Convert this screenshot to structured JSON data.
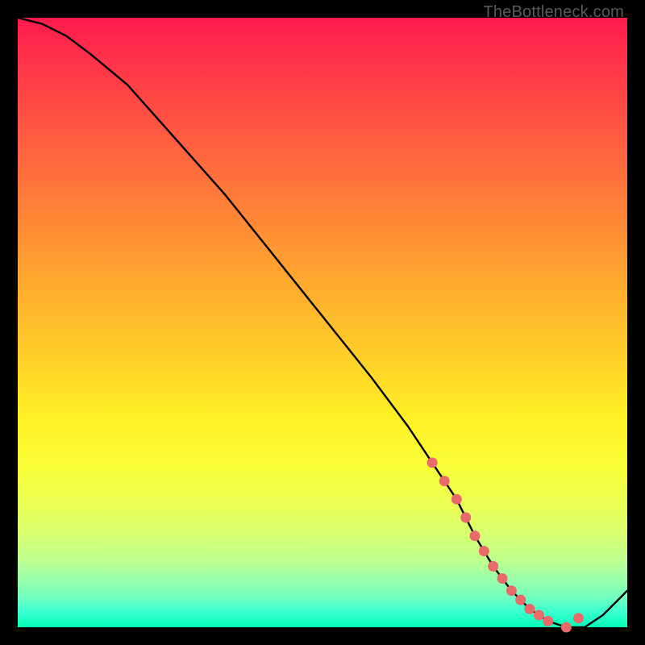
{
  "watermark": "TheBottleneck.com",
  "chart_data": {
    "type": "line",
    "title": "",
    "xlabel": "",
    "ylabel": "",
    "xlim": [
      0,
      100
    ],
    "ylim": [
      0,
      100
    ],
    "grid": false,
    "legend": false,
    "series": [
      {
        "name": "curve",
        "x": [
          0,
          4,
          8,
          12,
          18,
          26,
          34,
          42,
          50,
          58,
          64,
          68,
          72,
          75,
          78,
          81,
          84,
          87,
          90,
          93,
          96,
          100
        ],
        "values": [
          100,
          99,
          97,
          94,
          89,
          80,
          71,
          61,
          51,
          41,
          33,
          27,
          21,
          15,
          10,
          6,
          3,
          1,
          0,
          0,
          2,
          6
        ]
      }
    ],
    "markers": {
      "name": "highlight-dots",
      "color": "#e86a6a",
      "x": [
        68,
        70,
        72,
        73.5,
        75,
        76.5,
        78,
        79.5,
        81,
        82.5,
        84,
        85.5,
        87,
        90,
        92
      ],
      "values": [
        27,
        24,
        21,
        18,
        15,
        12.5,
        10,
        8,
        6,
        4.5,
        3,
        2,
        1,
        0,
        1.5
      ]
    }
  }
}
